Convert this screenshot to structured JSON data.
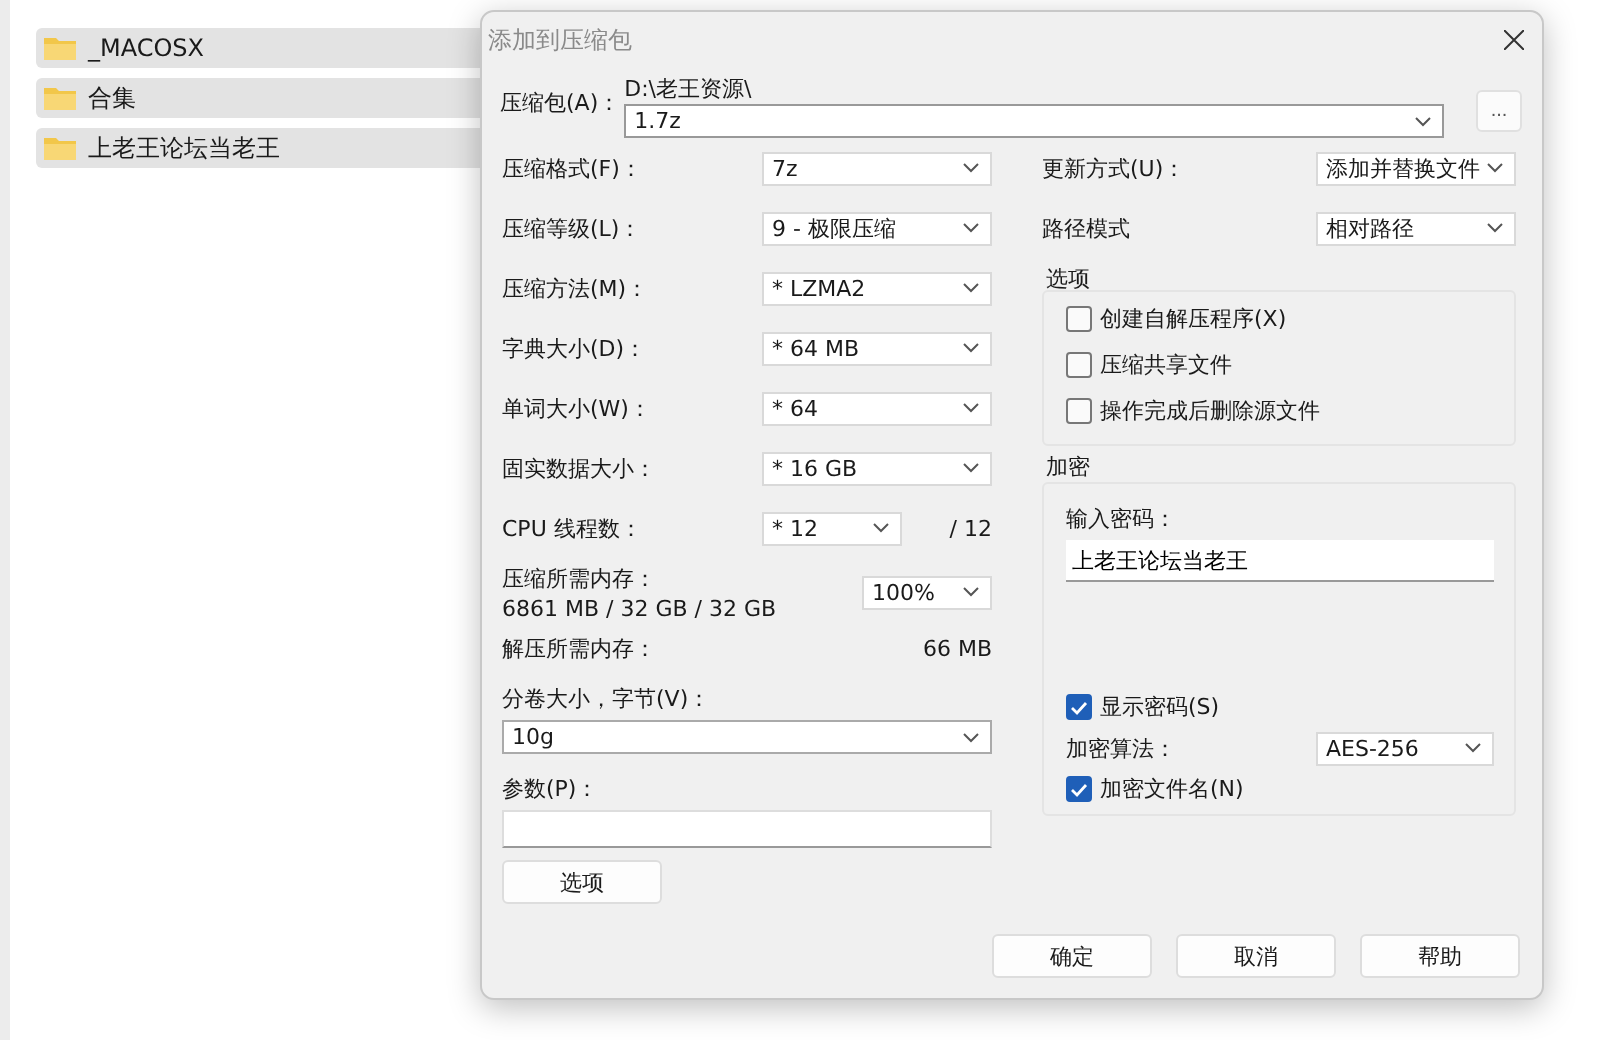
{
  "explorer": {
    "items": [
      {
        "name": "_MACOSX"
      },
      {
        "name": "合集"
      },
      {
        "name": "上老王论坛当老王"
      }
    ]
  },
  "dialog": {
    "title": "添加到压缩包",
    "archive": {
      "label": "压缩包(A)：",
      "path": "D:\\老王资源\\",
      "value": "1.7z"
    },
    "browse_button": "...",
    "left_fields": [
      {
        "label": "压缩格式(F)：",
        "value": "7z"
      },
      {
        "label": "压缩等级(L)：",
        "value": "9 - 极限压缩"
      },
      {
        "label": "压缩方法(M)：",
        "value": "* LZMA2"
      },
      {
        "label": "字典大小(D)：",
        "value": "* 64 MB"
      },
      {
        "label": "单词大小(W)：",
        "value": "* 64"
      },
      {
        "label": "固实数据大小：",
        "value": "* 16 GB"
      }
    ],
    "cpu": {
      "label": "CPU 线程数：",
      "value": "* 12",
      "total": "/ 12"
    },
    "memory": {
      "label": "压缩所需内存：",
      "reading": "6861 MB / 32 GB / 32 GB",
      "value": "100%"
    },
    "decompress_memory": {
      "label": "解压所需内存：",
      "reading": "66 MB"
    },
    "volume": {
      "label": "分卷大小，字节(V)：",
      "value": "10g"
    },
    "params": {
      "label": "参数(P)："
    },
    "options_button": "选项",
    "right_fields": [
      {
        "label": "更新方式(U)：",
        "value": "添加并替换文件"
      },
      {
        "label": "路径模式",
        "value": "相对路径"
      }
    ],
    "options_group": {
      "title": "选项",
      "checkboxes": [
        {
          "label": "创建自解压程序(X)",
          "checked": false
        },
        {
          "label": "压缩共享文件",
          "checked": false
        },
        {
          "label": "操作完成后删除源文件",
          "checked": false
        }
      ]
    },
    "encryption": {
      "title": "加密",
      "password_label": "输入密码：",
      "password": "上老王论坛当老王",
      "show_password": {
        "label": "显示密码(S)",
        "checked": true
      },
      "method_label": "加密算法：",
      "method": "AES-256",
      "encrypt_names": {
        "label": "加密文件名(N)",
        "checked": true
      }
    },
    "buttons": [
      "确定",
      "取消",
      "帮助"
    ]
  }
}
